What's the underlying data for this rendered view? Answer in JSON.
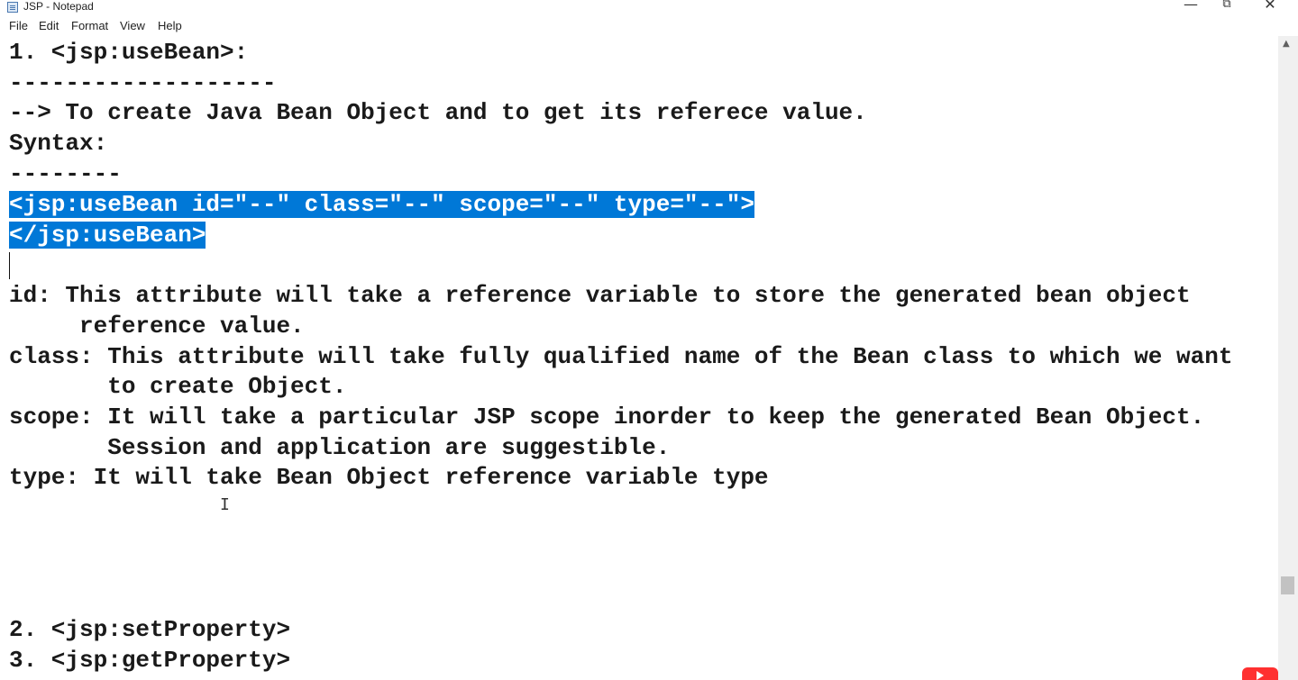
{
  "window": {
    "title": "JSP - Notepad",
    "controls": {
      "minimize": "—",
      "maximize": "⧉",
      "close": "✕"
    }
  },
  "menu": {
    "items": [
      "File",
      "Edit",
      "Format",
      "View",
      "Help"
    ]
  },
  "editor": {
    "lines": [
      "1. <jsp:useBean>:",
      "-------------------",
      "--> To create Java Bean Object and to get its referece value.",
      "Syntax:",
      "--------",
      "<jsp:useBean id=\"--\" class=\"--\" scope=\"--\" type=\"--\">",
      "</jsp:useBean>",
      "id: This attribute will take a reference variable to store the generated bean object",
      "     reference value.",
      "class: This attribute will take fully qualified name of the Bean class to which we want",
      "       to create Object.",
      "scope: It will take a particular JSP scope inorder to keep the generated Bean Object.",
      "       Session and application are suggestible.",
      "type: It will take Bean Object reference variable type",
      "2. <jsp:setProperty>",
      "3. <jsp:getProperty>"
    ]
  },
  "icons": {
    "app": "notepad-icon",
    "cursor": "i-beam-cursor-icon",
    "scroll_up": "scroll-up-arrow-icon",
    "overlay": "youtube-logo-icon"
  },
  "colors": {
    "selection": "#0078d7",
    "text": "#1a1a1a",
    "background": "#ffffff"
  }
}
